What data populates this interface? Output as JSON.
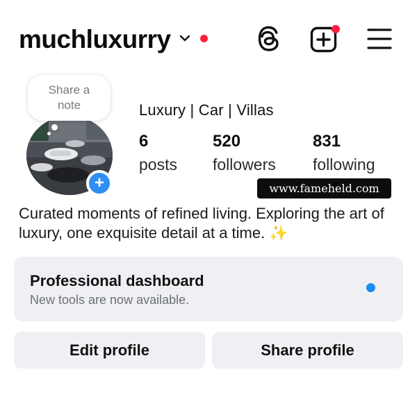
{
  "header": {
    "username": "muchluxurry",
    "icons": {
      "switch_account": "chevron-down-icon",
      "notification": "red-dot",
      "threads": "threads-icon",
      "create": "plus-square-icon",
      "menu": "hamburger-menu-icon"
    },
    "accent_red": "#ff1f3d"
  },
  "profile": {
    "note_bubble": "Share a note",
    "avatar_add_icon": "+",
    "bio_name": "Luxury | Car | Villas",
    "stats": [
      {
        "value": "6",
        "label": "posts"
      },
      {
        "value": "520",
        "label": "followers"
      },
      {
        "value": "831",
        "label": "following"
      }
    ],
    "bio": "Curated moments of refined living. Exploring the art of luxury, one exquisite detail at a time. ✨"
  },
  "watermark": "www.fameheld.com",
  "dashboard": {
    "title": "Professional dashboard",
    "subtitle": "New tools are now available.",
    "dot_color": "#1d8cf0"
  },
  "actions": {
    "edit_profile": "Edit profile",
    "share_profile": "Share profile"
  }
}
